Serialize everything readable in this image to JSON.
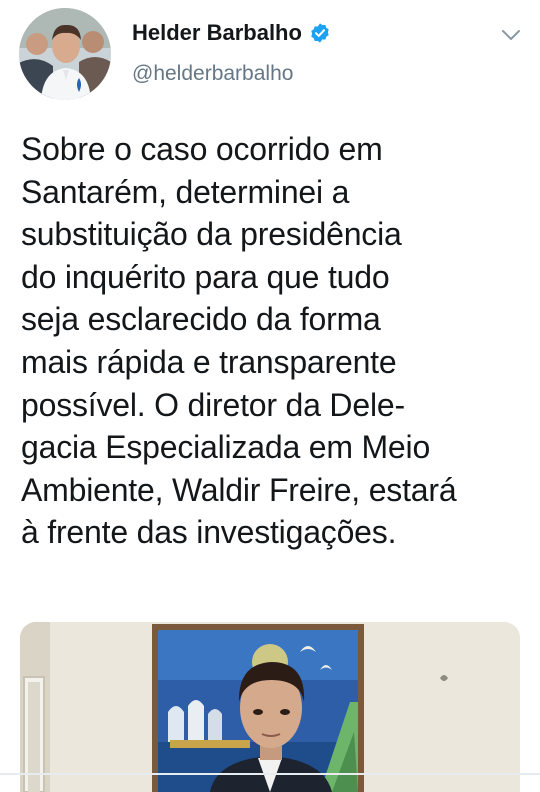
{
  "user": {
    "display_name": "Helder Barbalho",
    "handle": "@helderbarbalho",
    "verified": true
  },
  "tweet": {
    "text_lines": [
      "Sobre o caso ocorrido em",
      "Santarém, determinei a",
      "substituição da presidência",
      "do inquérito para que tudo",
      "seja esclarecido da forma",
      "mais rápida e transparente",
      "possível. O diretor da Dele-",
      "gacia Especializada em Meio",
      "Ambiente, Waldir Freire, estará",
      "à frente das investigações."
    ]
  },
  "icons": {
    "verified": "verified-badge-icon",
    "menu": "chevron-down-icon"
  },
  "colors": {
    "accent": "#1da1f2",
    "text": "#14171a",
    "secondary": "#657786"
  }
}
